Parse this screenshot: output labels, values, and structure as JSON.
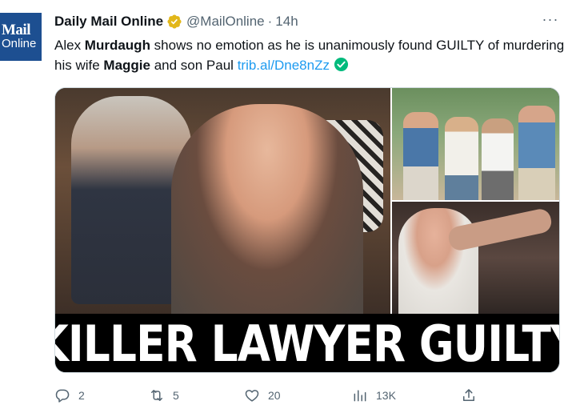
{
  "author": {
    "avatar_line1": "Mail",
    "avatar_line2": "Online",
    "name": "Daily Mail Online",
    "handle": "@MailOnline",
    "separator": "·",
    "time": "14h"
  },
  "menu": {
    "more_label": "···"
  },
  "tweet": {
    "seg1": "Alex ",
    "seg2": "Murdaugh",
    "seg3": " shows no emotion as he is unanimously found GUILTY of murdering his wife ",
    "seg4": "Maggie",
    "seg5": " and son Paul ",
    "link": "trib.al/Dne8nZz"
  },
  "media": {
    "banner_text": "KILLER LAWYER GUILTY"
  },
  "actions": {
    "reply_count": "2",
    "retweet_count": "5",
    "like_count": "20",
    "views_count": "13K"
  },
  "colors": {
    "link": "#1d9bf0",
    "verified": "#e2b719",
    "check": "#00ba7c",
    "muted": "#536471",
    "brand_avatar": "#1d4f91"
  },
  "icons": [
    "verified-badge-icon",
    "more-icon",
    "check-icon",
    "reply-icon",
    "retweet-icon",
    "like-icon",
    "views-icon",
    "share-icon"
  ]
}
